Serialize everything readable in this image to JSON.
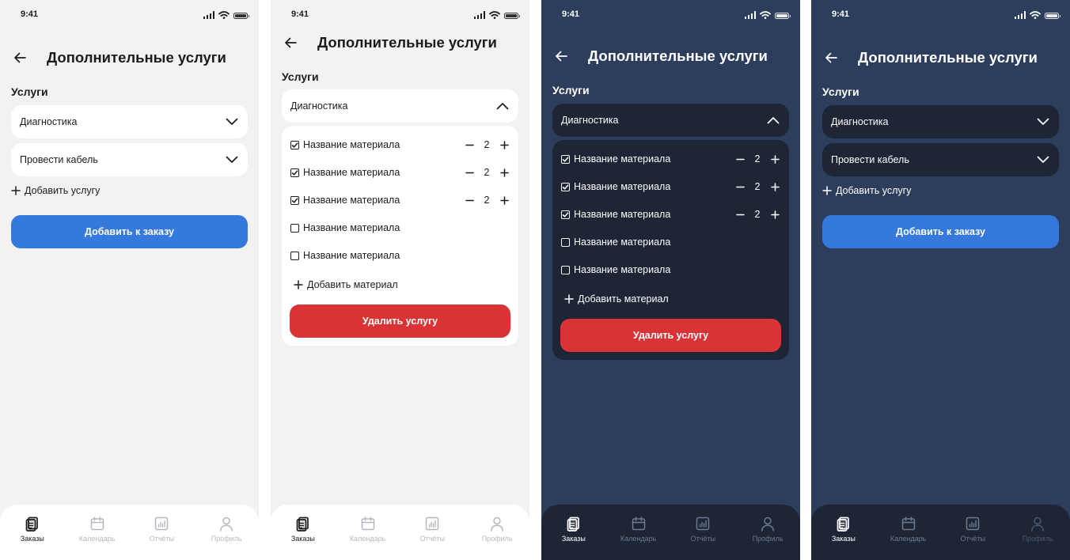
{
  "status_time": "9:41",
  "header_title": "Дополнительные услуги",
  "section_label": "Услуги",
  "services": [
    "Диагностика",
    "Провести кабель"
  ],
  "add_service_label": "Добавить услугу",
  "add_to_order_label": "Добавить к заказу",
  "expanded_service": "Диагностика",
  "materials": [
    {
      "name": "Название материала",
      "checked": true,
      "qty": "2"
    },
    {
      "name": "Название материала",
      "checked": true,
      "qty": "2"
    },
    {
      "name": "Название материала",
      "checked": true,
      "qty": "2"
    },
    {
      "name": "Название материала",
      "checked": false
    },
    {
      "name": "Название материала",
      "checked": false
    }
  ],
  "add_material_label": "Добавить материал",
  "delete_service_label": "Удалить услугу",
  "tabs": [
    {
      "label": "Заказы",
      "icon": "orders-icon"
    },
    {
      "label": "Календарь",
      "icon": "calendar-icon"
    },
    {
      "label": "Отчёты",
      "icon": "reports-icon"
    },
    {
      "label": "Профиль",
      "icon": "profile-icon"
    }
  ],
  "colors": {
    "light_bg": "#f2f2f2",
    "dark_bg": "#2c3e5b",
    "dark_card": "#1e2636",
    "accent_blue": "#3579dc",
    "danger_red": "#d93336"
  }
}
